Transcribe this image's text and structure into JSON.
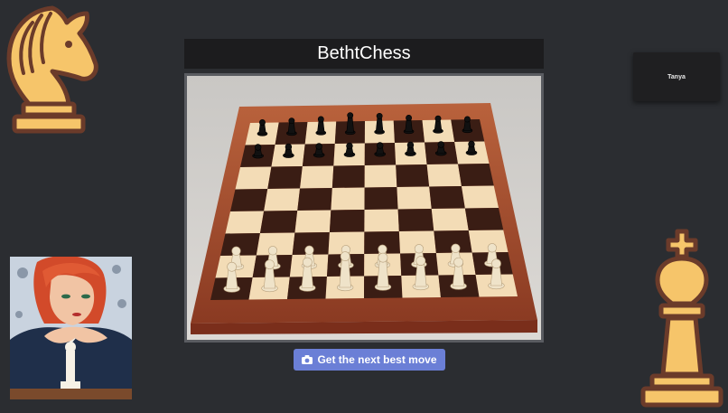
{
  "app": {
    "title": "BethtChess"
  },
  "user": {
    "name": "Tanya"
  },
  "actions": {
    "next_move_label": "Get the next best move"
  },
  "icons": {
    "logo_left": "chess-knight-icon",
    "logo_right": "chess-king-icon",
    "button_icon": "camera-icon"
  },
  "colors": {
    "background": "#2b2d31",
    "title_bar": "#1c1c1e",
    "button": "#6b7fd6",
    "piece_gold": "#f6c56a",
    "piece_outline": "#6b3b2a"
  }
}
